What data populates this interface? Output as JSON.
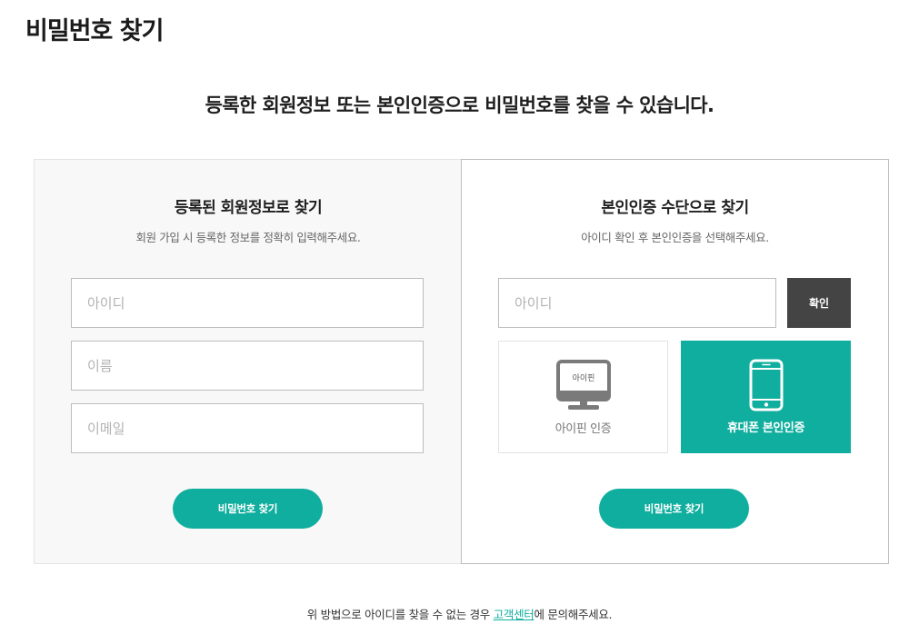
{
  "page_title": "비밀번호 찾기",
  "headline": "등록한 회원정보 또는 본인인증으로 비밀번호를 찾을 수 있습니다.",
  "colors": {
    "accent": "#10ae9e",
    "confirm_button": "#444444",
    "left_panel_bg": "#f8f8f8"
  },
  "member_info": {
    "title": "등록된 회원정보로 찾기",
    "description": "회원 가입 시 등록한 정보를 정확히 입력해주세요.",
    "id_placeholder": "아이디",
    "name_placeholder": "이름",
    "email_placeholder": "이메일",
    "submit_label": "비밀번호 찾기"
  },
  "identity_auth": {
    "title": "본인인증 수단으로 찾기",
    "description": "아이디 확인 후 본인인증을 선택해주세요.",
    "id_placeholder": "아이디",
    "confirm_label": "확인",
    "options": [
      {
        "label": "아이핀 인증",
        "icon": "monitor-icon",
        "icon_text": "아이핀",
        "selected": false
      },
      {
        "label": "휴대폰 본인인증",
        "icon": "smartphone-icon",
        "selected": true
      }
    ],
    "submit_label": "비밀번호 찾기"
  },
  "footer": {
    "text_before": "위 방법으로 아이디를 찾을 수 없는 경우 ",
    "link_label": "고객센터",
    "text_after": "에 문의해주세요."
  }
}
